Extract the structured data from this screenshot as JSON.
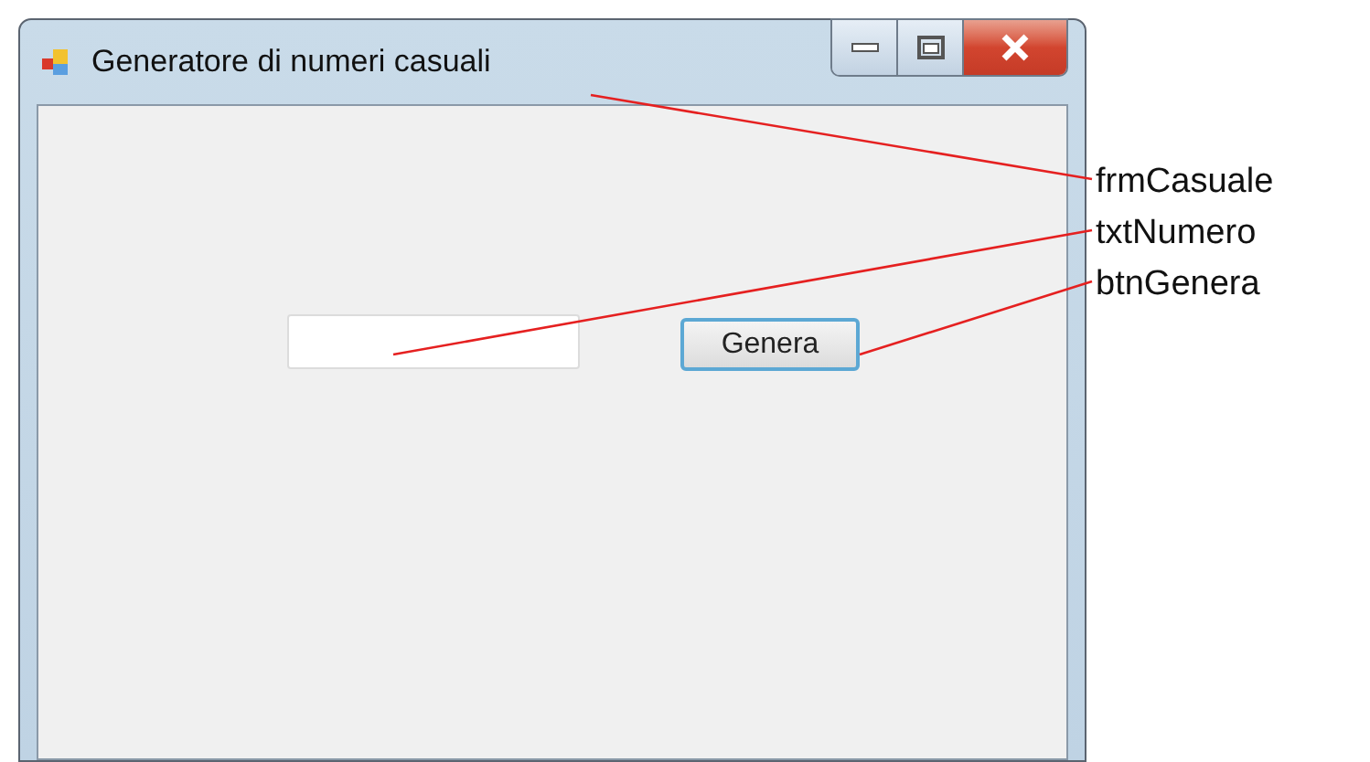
{
  "window": {
    "title": "Generatore di numeri casuali"
  },
  "controls": [
    {
      "kind": "textbox"
    },
    {
      "kind": "button",
      "label": "Genera"
    }
  ],
  "annotations": [
    {
      "label": "frmCasuale"
    },
    {
      "label": "txtNumero"
    },
    {
      "label": "btnGenera"
    }
  ]
}
